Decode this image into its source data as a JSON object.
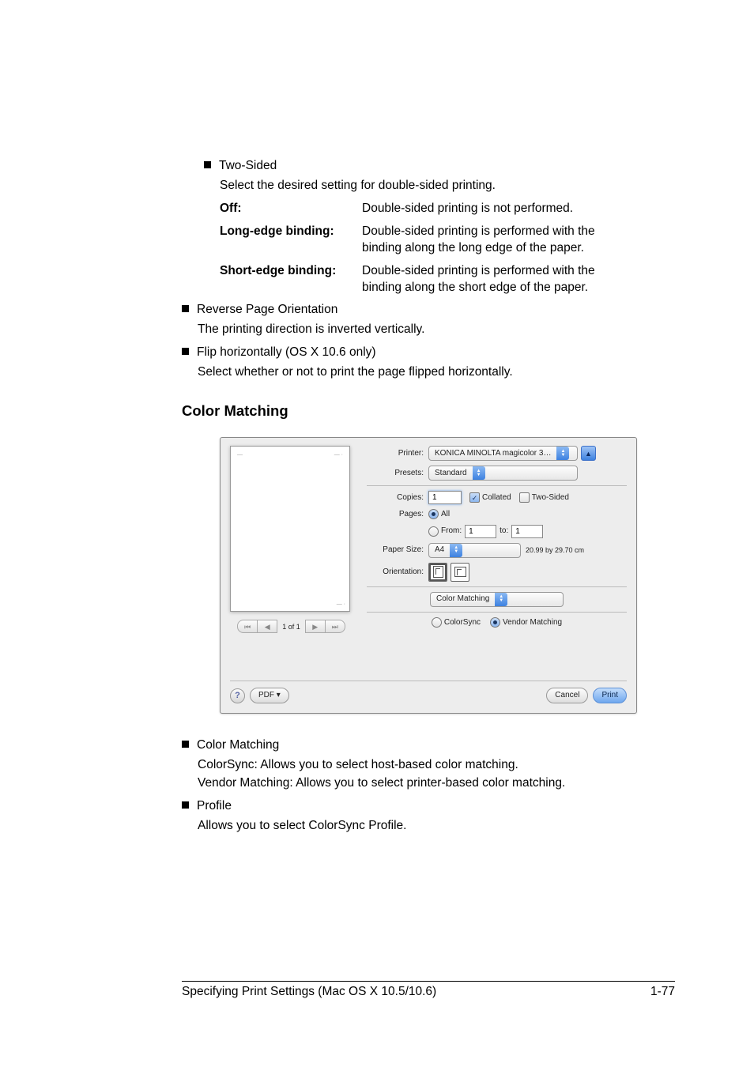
{
  "bullet1": {
    "title": "Two-Sided",
    "desc": "Select the desired setting for double-sided printing."
  },
  "opts": [
    {
      "label": "Off:",
      "val": "Double-sided printing is not performed."
    },
    {
      "label": "Long-edge binding:",
      "val": "Double-sided printing is performed with the binding along the long edge of the paper."
    },
    {
      "label": "Short-edge binding:",
      "val": "Double-sided printing is performed with the binding along the short edge of the paper."
    }
  ],
  "bullet2": {
    "title": "Reverse Page Orientation",
    "desc": "The printing direction is inverted vertically."
  },
  "bullet3": {
    "title": "Flip horizontally (OS X 10.6 only)",
    "desc": "Select whether or not to print the page flipped horizontally."
  },
  "sectionHeading": "Color Matching",
  "dialog": {
    "printerLabel": "Printer:",
    "printerVal": "KONICA MINOLTA magicolor 3…",
    "presetsLabel": "Presets:",
    "presetsVal": "Standard",
    "copiesLabel": "Copies:",
    "copiesVal": "1",
    "collated": "Collated",
    "twoSided": "Two-Sided",
    "pagesLabel": "Pages:",
    "pagesAll": "All",
    "pagesFrom": "From:",
    "fromVal": "1",
    "to": "to:",
    "toVal": "1",
    "paperSizeLabel": "Paper Size:",
    "paperSizeVal": "A4",
    "paperDims": "20.99 by 29.70 cm",
    "orientationLabel": "Orientation:",
    "sectionSel": "Color Matching",
    "colorsync": "ColorSync",
    "vendor": "Vendor Matching",
    "previewNav": "1 of 1",
    "help": "?",
    "pdf": "PDF ▾",
    "cancel": "Cancel",
    "print": "Print",
    "collapseIcon": "▲"
  },
  "bullet4": {
    "title": "Color Matching",
    "line1": "ColorSync: Allows you to select host-based color matching.",
    "line2": "Vendor Matching: Allows you to select printer-based color matching."
  },
  "bullet5": {
    "title": "Profile",
    "desc": "Allows you to select ColorSync Profile."
  },
  "footer": {
    "left": "Specifying Print Settings (Mac OS X 10.5/10.6)",
    "right": "1-77"
  }
}
